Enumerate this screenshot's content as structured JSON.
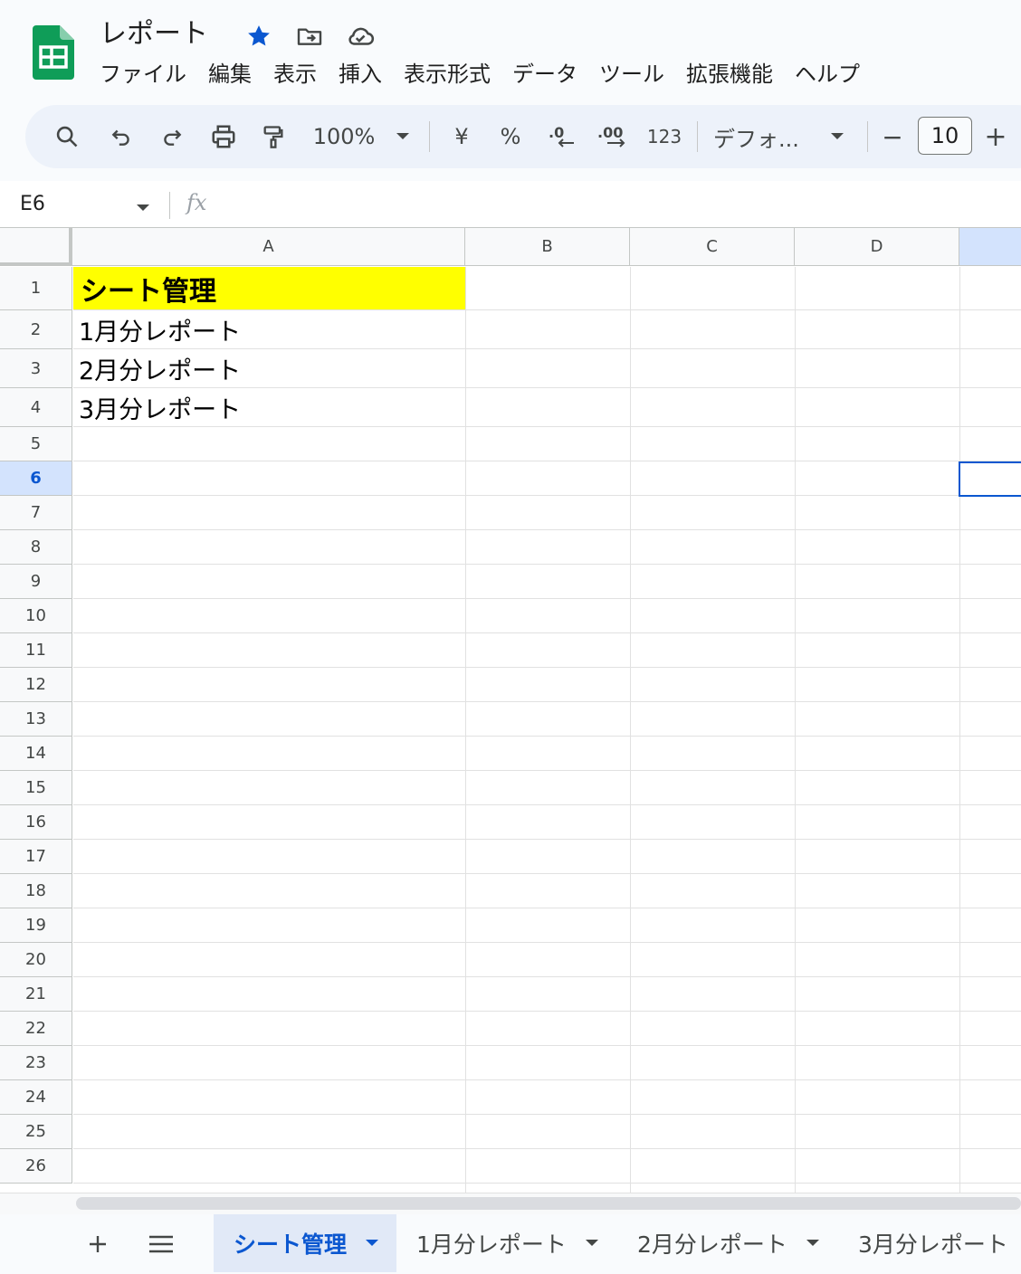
{
  "app": {
    "doc_title": "レポート",
    "brand_color": "#0F9D58",
    "accent_color": "#0b57d0"
  },
  "title_icons": [
    "star-icon",
    "move-to-folder-icon",
    "cloud-saved-icon"
  ],
  "menu": [
    "ファイル",
    "編集",
    "表示",
    "挿入",
    "表示形式",
    "データ",
    "ツール",
    "拡張機能",
    "ヘルプ"
  ],
  "toolbar": {
    "zoom": "100%",
    "currency": "¥",
    "percent": "%",
    "number_format": "123",
    "font_name": "デフォ...",
    "font_size": "10",
    "minus": "−",
    "plus": "+"
  },
  "formula_bar": {
    "cell_ref": "E6",
    "fx": "fx",
    "value": ""
  },
  "grid": {
    "columns": [
      "A",
      "B",
      "C",
      "D",
      ""
    ],
    "rows": [
      "1",
      "2",
      "3",
      "4",
      "5",
      "6",
      "7",
      "8",
      "9",
      "10",
      "11",
      "12",
      "13",
      "14",
      "15",
      "16",
      "17",
      "18",
      "19",
      "20",
      "21",
      "22",
      "23",
      "24",
      "25",
      "26"
    ],
    "selected_row": "6",
    "cells": {
      "A1": "シート管理",
      "A2": "1月分レポート",
      "A3": "2月分レポート",
      "A4": "3月分レポート"
    },
    "a1_fill": "#ffff00"
  },
  "sheet_tabs": {
    "add": "+",
    "list": "≡",
    "tabs": [
      {
        "label": "シート管理",
        "active": true
      },
      {
        "label": "1月分レポート",
        "active": false
      },
      {
        "label": "2月分レポート",
        "active": false
      },
      {
        "label": "3月分レポート",
        "active": false
      }
    ]
  }
}
